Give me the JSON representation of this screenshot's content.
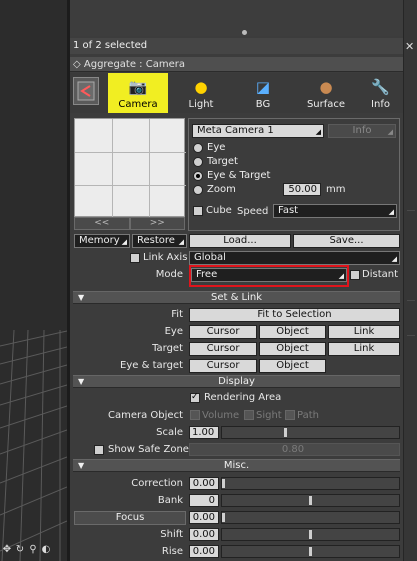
{
  "selection": {
    "status": "1 of 2 selected"
  },
  "aggregate": {
    "title": "Aggregate : Camera"
  },
  "tabs": [
    {
      "label": "Camera",
      "icon": "camera-icon",
      "active": true
    },
    {
      "label": "Light",
      "icon": "light-bulb-icon",
      "active": false
    },
    {
      "label": "BG",
      "icon": "background-icon",
      "active": false
    },
    {
      "label": "Surface",
      "icon": "surface-sphere-icon",
      "active": false
    },
    {
      "label": "Info",
      "icon": "wrench-info-icon",
      "active": false
    }
  ],
  "preview": {
    "prev": "<<",
    "next": ">>"
  },
  "camera": {
    "name": "Meta Camera 1",
    "info_label": "Info",
    "radios": [
      "Eye",
      "Target",
      "Eye & Target",
      "Zoom"
    ],
    "selected_radio": "Eye & Target",
    "zoom_value": "50.00",
    "zoom_unit": "mm",
    "cube_label": "Cube",
    "speed_label": "Speed",
    "speed_value": "Fast"
  },
  "memory": {
    "memory": "Memory",
    "restore": "Restore",
    "load": "Load...",
    "save": "Save..."
  },
  "link_axis": {
    "label": "Link Axis",
    "value": "Global"
  },
  "mode": {
    "label": "Mode",
    "value": "Free",
    "distant_label": "Distant"
  },
  "set_link": {
    "title": "Set & Link",
    "fit_label": "Fit",
    "fit_button": "Fit to Selection",
    "rows": [
      {
        "label": "Eye",
        "b1": "Cursor",
        "b2": "Object",
        "b3": "Link"
      },
      {
        "label": "Target",
        "b1": "Cursor",
        "b2": "Object",
        "b3": "Link"
      },
      {
        "label": "Eye & target",
        "b1": "Cursor",
        "b2": "Object"
      }
    ]
  },
  "display": {
    "title": "Display",
    "rendering_area": "Rendering Area",
    "camera_object_label": "Camera Object",
    "volume": "Volume",
    "sight": "Sight",
    "path": "Path",
    "scale_label": "Scale",
    "scale_value": "1.00",
    "scale_level": 0.35,
    "safe_zone_label": "Show Safe Zone",
    "safe_zone_value": "0.80"
  },
  "misc": {
    "title": "Misc.",
    "correction_label": "Correction",
    "correction_value": "0.00",
    "bank_label": "Bank",
    "bank_value": "0",
    "focus_label": "Focus",
    "focus_value": "0.00",
    "shift_label": "Shift",
    "shift_value": "0.00",
    "rise_label": "Rise",
    "rise_value": "0.00"
  },
  "viewport_tools": [
    "move-icon",
    "rotate-icon",
    "zoom-icon",
    "orbit-icon"
  ],
  "colors": {
    "active_tab": "#f1ee22",
    "highlight_outline": "#e0141c",
    "panel_bg": "#3c3c3c"
  }
}
